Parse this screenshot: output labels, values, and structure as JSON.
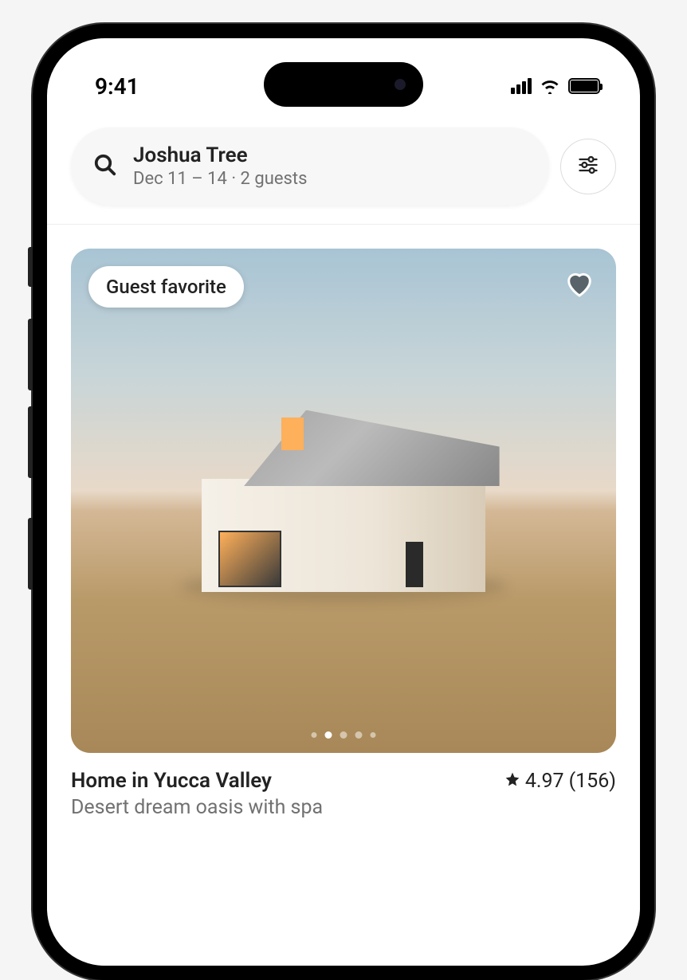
{
  "status_bar": {
    "time": "9:41"
  },
  "search": {
    "location": "Joshua Tree",
    "details": "Dec 11 – 14 · 2 guests"
  },
  "listing": {
    "badge": "Guest favorite",
    "title": "Home in Yucca Valley",
    "subtitle": "Desert dream oasis with spa",
    "rating": "4.97",
    "review_count": "(156)",
    "carousel": {
      "total_dots": 5,
      "active_index": 1
    }
  }
}
